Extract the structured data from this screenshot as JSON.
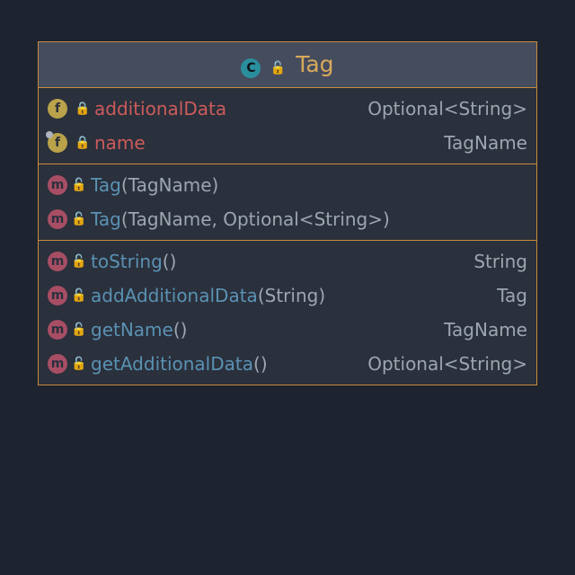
{
  "header": {
    "class_badge": "C",
    "lock": "open",
    "name": "Tag"
  },
  "fields": [
    {
      "badge": "f",
      "has_final": false,
      "lock": "closed",
      "name": "additionalData",
      "type": "Optional<String>"
    },
    {
      "badge": "f",
      "has_final": true,
      "lock": "closed",
      "name": "name",
      "type": "TagName"
    }
  ],
  "constructors": [
    {
      "badge": "m",
      "lock": "open",
      "name": "Tag",
      "sig_open": "(",
      "params": "TagName",
      "sig_close": ")",
      "ret": ""
    },
    {
      "badge": "m",
      "lock": "open",
      "name": "Tag",
      "sig_open": "(",
      "params": "TagName, Optional<String>",
      "sig_close": ")",
      "ret": ""
    }
  ],
  "methods": [
    {
      "badge": "m",
      "lock": "open",
      "name": "toString",
      "sig_open": "(",
      "params": "",
      "sig_close": ")",
      "ret": "String"
    },
    {
      "badge": "m",
      "lock": "open",
      "name": "addAdditionalData",
      "sig_open": "(",
      "params": "String",
      "sig_close": ")",
      "ret": "Tag"
    },
    {
      "badge": "m",
      "lock": "open",
      "name": "getName",
      "sig_open": "(",
      "params": "",
      "sig_close": ")",
      "ret": "TagName"
    },
    {
      "badge": "m",
      "lock": "open",
      "name": "getAdditionalData",
      "sig_open": "(",
      "params": "",
      "sig_close": ")",
      "ret": "Optional<String>"
    }
  ]
}
